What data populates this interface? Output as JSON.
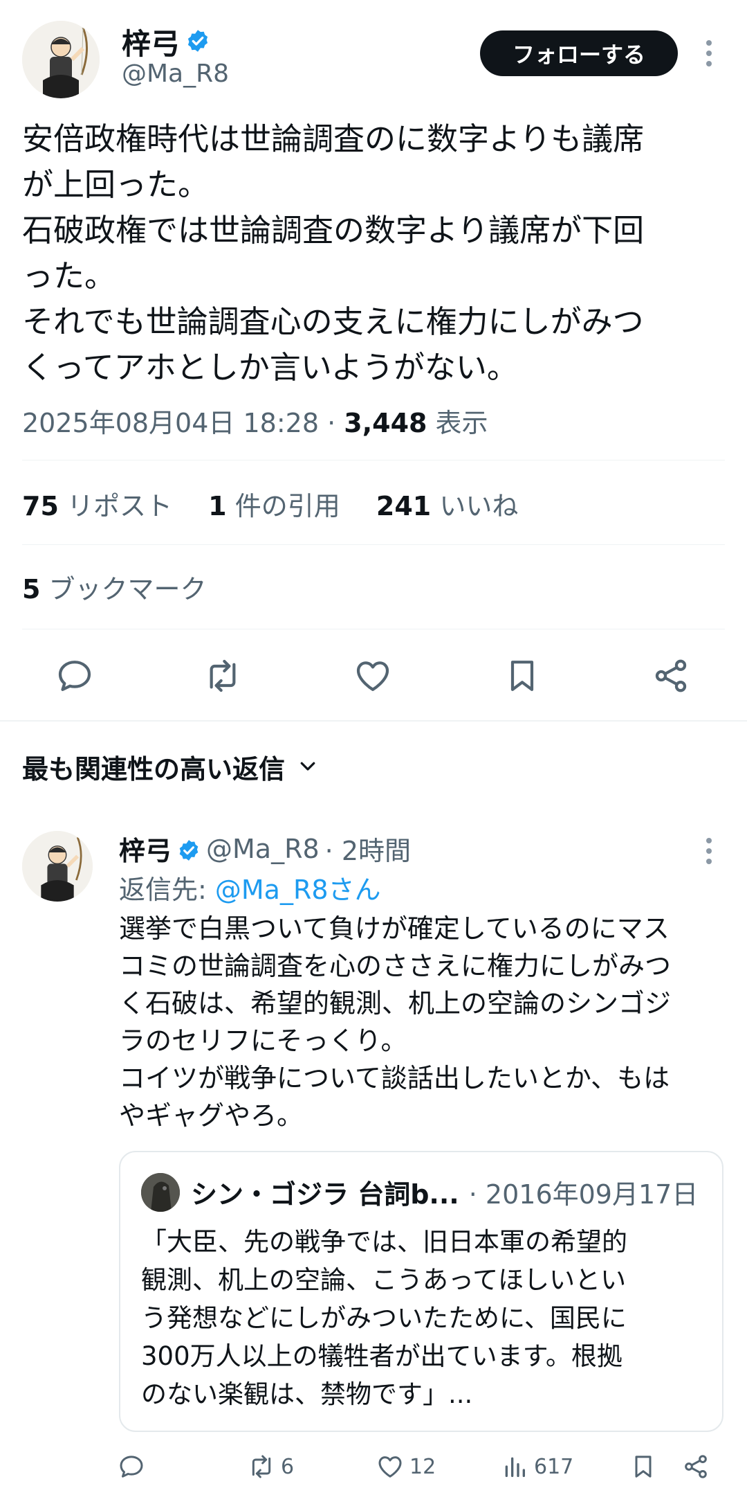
{
  "main_tweet": {
    "author_name": "梓弓",
    "handle": "@Ma_R8",
    "follow_label": "フォローする",
    "text": "安倍政権時代は世論調査のに数字よりも議席\nが上回った。\n石破政権では世論調査の数字より議席が下回\nった。\nそれでも世論調査心の支えに権力にしがみつ\nくってアホとしか言いようがない。",
    "timestamp": "2025年08月04日 18:28 · ",
    "views_count": "3,448",
    "views_label": " 表示"
  },
  "stats": {
    "reposts_count": "75",
    "reposts_label": " リポスト",
    "quotes_count": "1",
    "quotes_label": " 件の引用",
    "likes_count": "241",
    "likes_label": " いいね",
    "bookmarks_count": "5",
    "bookmarks_label": " ブックマーク"
  },
  "replies_header": {
    "label": "最も関連性の高い返信"
  },
  "reply": {
    "author_name": "梓弓",
    "handle": "@Ma_R8",
    "time": "· 2時間",
    "reply_to_prefix": "返信先: ",
    "reply_to_handle": "@Ma_R8さん",
    "text": "選挙で白黒ついて負けが確定しているのにマス\nコミの世論調査を心のささえに権力にしがみつ\nく石破は、希望的観測、机上の空論のシンゴジ\nラのセリフにそっくり。\nコイツが戦争について談話出したいとか、もは\nやギャグやろ。",
    "quote": {
      "author_name": "シン・ゴジラ 台詞b...",
      "date": "· 2016年09月17日",
      "text": "「大臣、先の戦争では、旧日本軍の希望的\n観測、机上の空論、こうあってほしいとい\nう発想などにしがみついたために、国民に\n300万人以上の犠牲者が出ています。根拠\nのない楽観は、禁物です」..."
    },
    "actions": {
      "reposts": "6",
      "likes": "12",
      "views": "617"
    }
  },
  "colors": {
    "text": "#0f1419",
    "muted": "#536471",
    "link": "#1d9bf0",
    "verified": "#1d9bf0",
    "divider": "#eff3f4"
  }
}
